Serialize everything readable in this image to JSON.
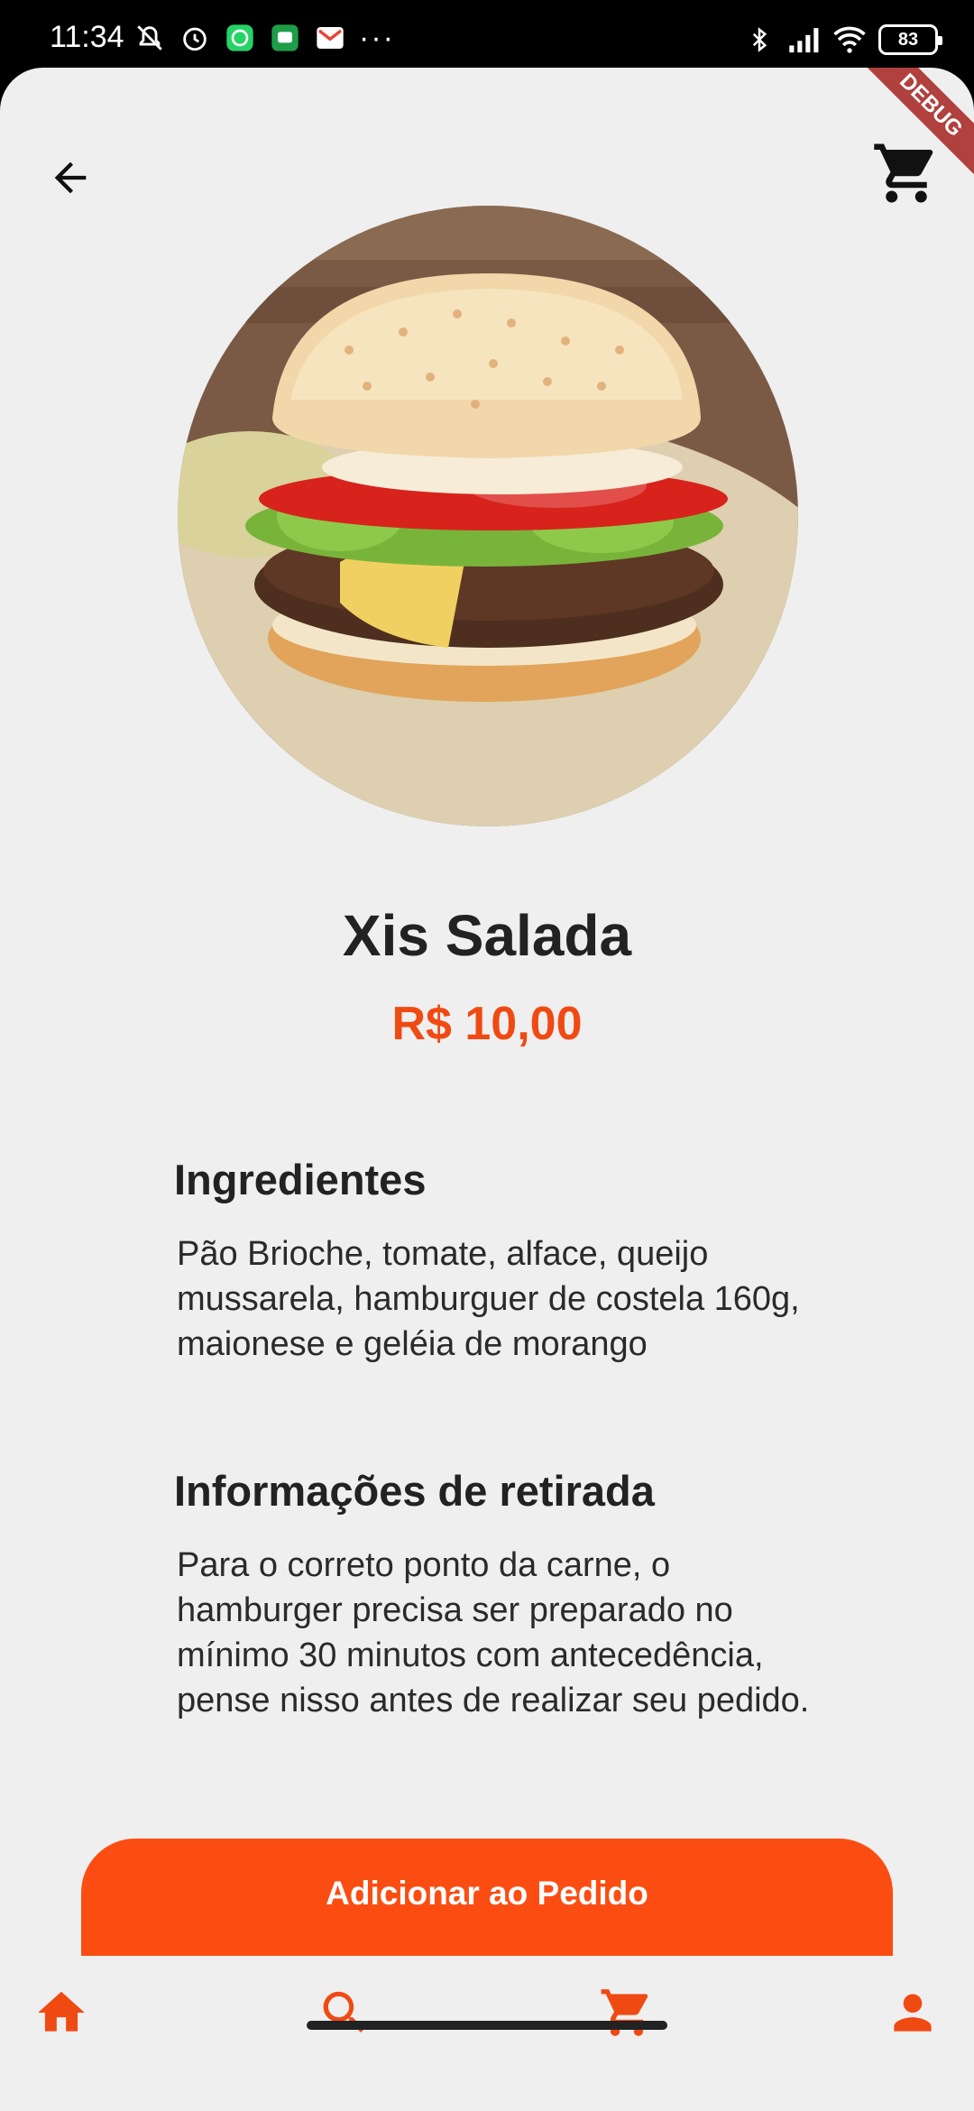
{
  "status_bar": {
    "time": "11:34",
    "more": "···",
    "battery": "83"
  },
  "debug_banner": "DEBUG",
  "product": {
    "name": "Xis Salada",
    "price": "R$ 10,00"
  },
  "sections": {
    "ingredients_title": "Ingredientes",
    "ingredients_text": "Pão Brioche, tomate, alface, queijo mussarela, hamburguer de costela 160g,  maionese e geléia de morango",
    "pickup_title": "Informações de retirada",
    "pickup_text": "Para o correto ponto da carne, o hamburger precisa ser preparado no mínimo 30 minutos com antecedência, pense nisso antes de realizar seu pedido."
  },
  "actions": {
    "add_to_order": "Adicionar ao Pedido"
  },
  "nav": {
    "items": [
      "home-icon",
      "search-icon",
      "cart-icon",
      "profile-icon"
    ],
    "accent": "#f04a13"
  },
  "colors": {
    "accent": "#fb4d12",
    "background": "#efefef"
  }
}
